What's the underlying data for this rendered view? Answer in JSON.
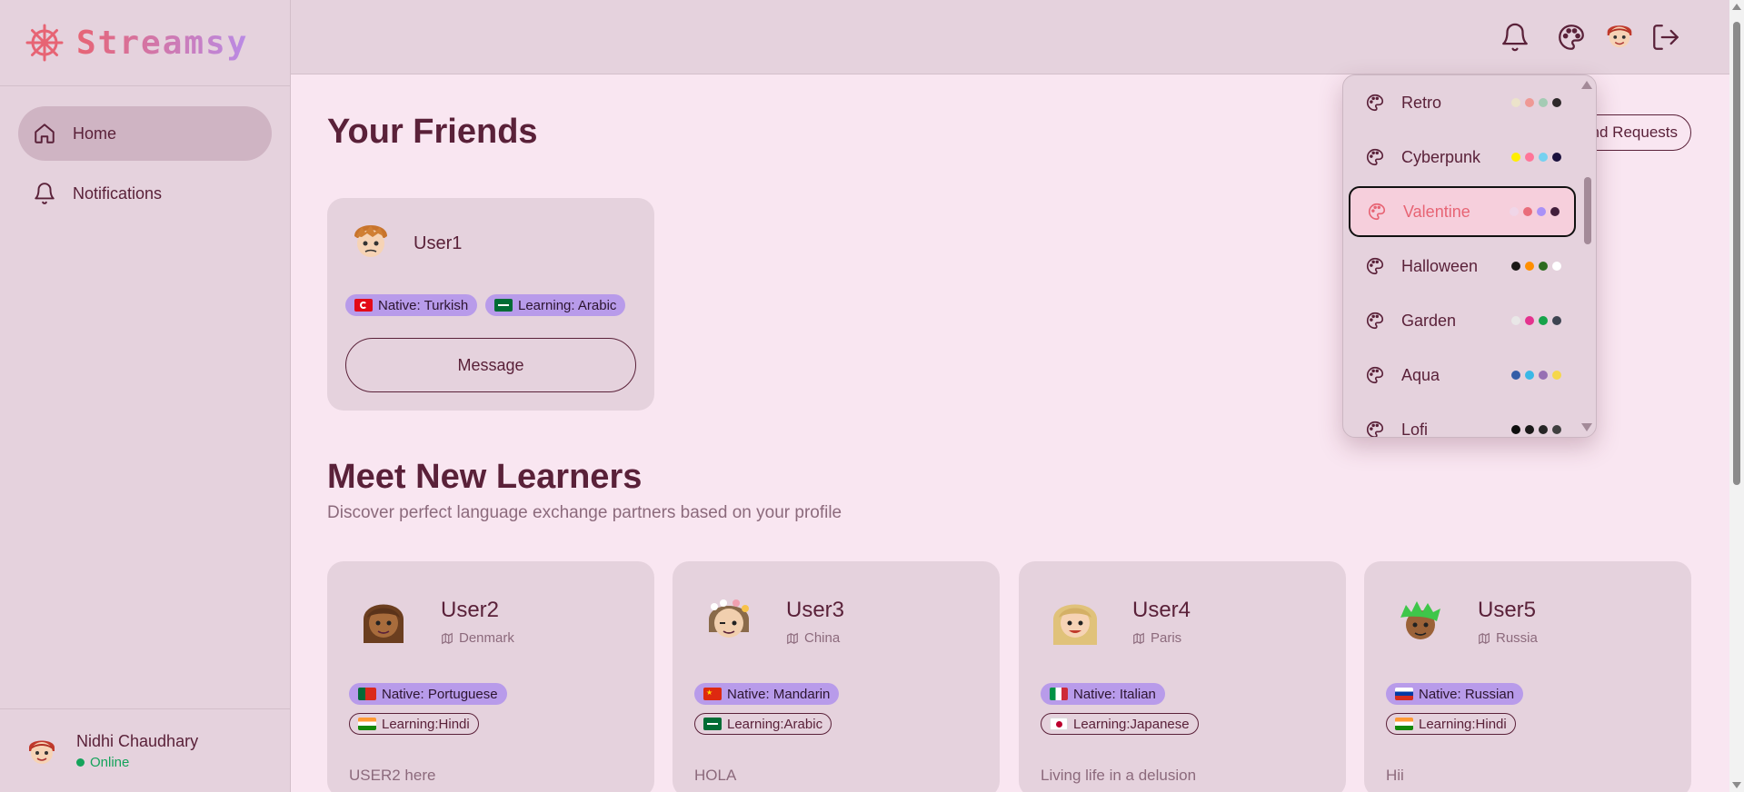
{
  "app": {
    "name": "Streamsy"
  },
  "sidebar": {
    "items": [
      {
        "label": "Home",
        "icon": "home-icon",
        "active": true
      },
      {
        "label": "Notifications",
        "icon": "bell-icon",
        "active": false
      }
    ],
    "user": {
      "name": "Nidhi Chaudhary",
      "status": "Online"
    }
  },
  "header": {
    "icons": [
      "bell-icon",
      "palette-icon",
      "avatar",
      "logout-icon"
    ]
  },
  "main": {
    "friends_title": "Your Friends",
    "friend_requests_label": "Friend Requests",
    "friends": [
      {
        "name": "User1",
        "native": "Native: Turkish",
        "learning": "Learning: Arabic",
        "message_label": "Message"
      }
    ],
    "learners_title": "Meet New Learners",
    "learners_subtitle": "Discover perfect language exchange partners based on your profile",
    "learners": [
      {
        "name": "User2",
        "location": "Denmark",
        "native": "Native: Portuguese",
        "learning": "Learning:Hindi",
        "bio": "USER2 here"
      },
      {
        "name": "User3",
        "location": "China",
        "native": "Native: Mandarin",
        "learning": "Learning:Arabic",
        "bio": "HOLA"
      },
      {
        "name": "User4",
        "location": "Paris",
        "native": "Native: Italian",
        "learning": "Learning:Japanese",
        "bio": "Living life in a delusion"
      },
      {
        "name": "User5",
        "location": "Russia",
        "native": "Native: Russian",
        "learning": "Learning:Hindi",
        "bio": "Hii"
      }
    ]
  },
  "theme_menu": {
    "items": [
      {
        "label": "Retro",
        "swatches": [
          "#ece3ca",
          "#ef9995",
          "#a4cbb4",
          "#2e282a"
        ]
      },
      {
        "label": "Cyberpunk",
        "swatches": [
          "#ffee00",
          "#ff7598",
          "#75d1f0",
          "#1a103d"
        ]
      },
      {
        "label": "Valentine",
        "swatches": [
          "#f0d6e8",
          "#e96d7b",
          "#a991f7",
          "#421f3c"
        ],
        "active": true
      },
      {
        "label": "Halloween",
        "swatches": [
          "#1b1816",
          "#ff8f00",
          "#2d6b1f",
          "#ffffff"
        ]
      },
      {
        "label": "Garden",
        "swatches": [
          "#e9e7e7",
          "#e4328e",
          "#16a34a",
          "#3d4451"
        ]
      },
      {
        "label": "Aqua",
        "swatches": [
          "#345da7",
          "#3ab8e6",
          "#966fb3",
          "#f5d74b"
        ]
      },
      {
        "label": "Lofi",
        "swatches": [
          "#0d0d0d",
          "#1a1919",
          "#262626",
          "#404040"
        ]
      }
    ]
  },
  "colors": {
    "accent": "#e76474",
    "primary_text": "#5a2139",
    "badge_fill": "#b89bea",
    "online": "#15a35b"
  }
}
